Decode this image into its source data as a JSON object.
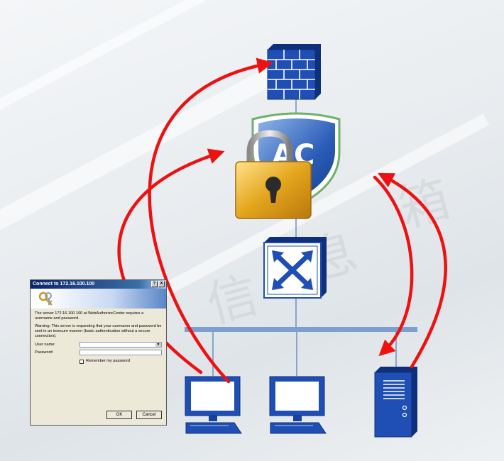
{
  "dialog": {
    "title": "Connect to 172.16.100.100",
    "close_glyph": "X",
    "help_glyph": "?",
    "message": "The server 172.16.100.100 at WebAuthorizeCenter requires a username and password.",
    "warning": "Warning: This server is requesting that your username and password be sent in an insecure manner (basic authentication without a secure connection).",
    "username_label": "User name:",
    "password_label": "Password:",
    "remember_label": "Remember my password",
    "ok_label": "OK",
    "cancel_label": "Cancel"
  },
  "ac_label": "AC",
  "watermark": [
    "信",
    "息",
    "箱"
  ],
  "colors": {
    "device_blue": "#1f4fb5",
    "link_line": "#6f8fc0",
    "bus": "#7d9fd0",
    "arrow": "#ee1111",
    "lock_gold": "#e3a51c"
  },
  "icons": [
    "firewall-icon",
    "ac-shield-icon",
    "padlock-icon",
    "switch-icon",
    "pc-icon",
    "pc-icon",
    "server-icon"
  ]
}
